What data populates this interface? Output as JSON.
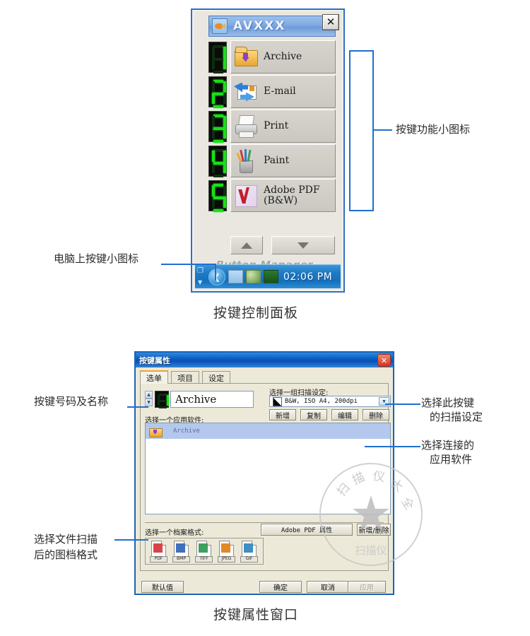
{
  "panel": {
    "window_title": "AVXXX",
    "app_icon": "fish-icon",
    "close_label": "✕",
    "brand": "Button Manager",
    "buttons": [
      {
        "digit": "1",
        "label": "Archive",
        "icon": "archive-folder-icon"
      },
      {
        "digit": "2",
        "label": "E-mail",
        "icon": "email-icon"
      },
      {
        "digit": "3",
        "label": "Print",
        "icon": "printer-icon"
      },
      {
        "digit": "4",
        "label": "Paint",
        "icon": "paint-brushes-icon"
      },
      {
        "digit": "5",
        "label": "Adobe PDF\n(B&W)",
        "icon": "adobe-pdf-icon"
      }
    ],
    "scroll_up": "▲",
    "scroll_down": "▼",
    "taskbar": {
      "chevron": "❮",
      "clock": "02:06 PM",
      "tray_icons": [
        "button-manager-tray-icon",
        "network-error-tray-icon",
        "scanner-tray-icon"
      ]
    }
  },
  "panel_caption": "按键控制面板",
  "annotations": {
    "function_icons": "按键功能小图标",
    "computer_button_icon": "电脑上按键小图标",
    "button_number_name": "按键号码及名称",
    "scan_setting": [
      "选择此按键",
      "的扫描设定"
    ],
    "linked_app": [
      "选择连接的",
      "应用软件"
    ],
    "file_format": [
      "选择文件扫描",
      "后的图档格式"
    ]
  },
  "dialog": {
    "title": "按键属性",
    "close_label": "✕",
    "tabs": [
      {
        "label": "选单",
        "active": true
      },
      {
        "label": "项目",
        "active": false
      },
      {
        "label": "设定",
        "active": false
      }
    ],
    "button_number": "1",
    "button_name": "Archive",
    "scan_group_label": "选择一组扫描设定:",
    "scan_profile": "B&W, ISO A4, 200dpi",
    "profile_buttons": [
      "新增",
      "复制",
      "编辑",
      "删除"
    ],
    "app_label": "选择一个应用软件:",
    "app_items": [
      {
        "name": "Archive",
        "icon": "archive-folder-icon",
        "selected": true
      }
    ],
    "format_label": "选择一个档案格式:",
    "pdf_properties_button": "Adobe PDF 属性",
    "add_remove_button": "新增/删除",
    "formats": [
      {
        "label": "PDF",
        "color": "#d6444a"
      },
      {
        "label": "BMP",
        "color": "#3f6fbf"
      },
      {
        "label": "TIFF",
        "color": "#3f9f5f"
      },
      {
        "label": "JPEG",
        "color": "#e08a2a"
      },
      {
        "label": "GIF",
        "color": "#3f8fbf"
      }
    ],
    "footer_buttons": [
      {
        "label": "默认值",
        "disabled": false
      },
      {
        "label": "确定",
        "disabled": false
      },
      {
        "label": "取消",
        "disabled": false
      },
      {
        "label": "应用",
        "disabled": true
      }
    ]
  },
  "dialog_caption": "按键属性窗口",
  "watermark": {
    "ring_chars": [
      "扫",
      "描",
      "仪",
      "大",
      "全"
    ],
    "bottom_text": "扫描仪"
  },
  "colors": {
    "lead_line": "#1f6fd0",
    "panel_border": "#2f6fc4",
    "dialog_border": "#1c63b8",
    "led_on": "#17e017",
    "taskbar": "#1b7ac6"
  }
}
